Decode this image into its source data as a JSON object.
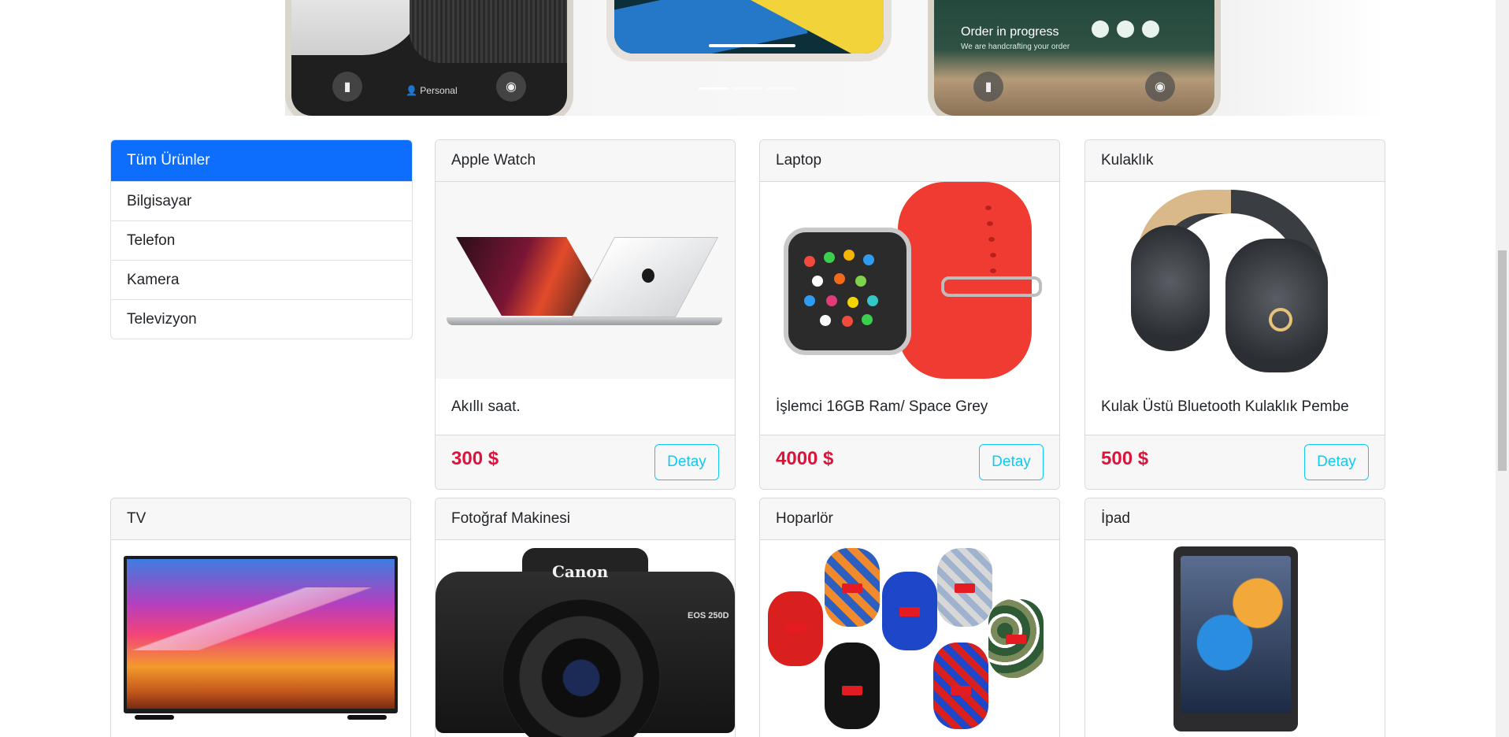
{
  "carousel": {
    "slides": [
      {
        "name": "personal",
        "label": "Personal"
      },
      {
        "name": "wallpaper"
      },
      {
        "name": "order",
        "title": "Order in progress",
        "subtitle": "We are handcrafting your order"
      }
    ],
    "active_index": 0,
    "indicator_count": 3
  },
  "categories": {
    "items": [
      {
        "label": "Tüm Ürünler",
        "active": true
      },
      {
        "label": "Bilgisayar",
        "active": false
      },
      {
        "label": "Telefon",
        "active": false
      },
      {
        "label": "Kamera",
        "active": false
      },
      {
        "label": "Televizyon",
        "active": false
      }
    ]
  },
  "products": [
    {
      "title": "Apple Watch",
      "description": "Akıllı saat.",
      "price": "300 $",
      "button": "Detay",
      "image": "laptop"
    },
    {
      "title": "Laptop",
      "description": "İşlemci 16GB Ram/ Space Grey",
      "price": "4000 $",
      "button": "Detay",
      "image": "watch"
    },
    {
      "title": "Kulaklık",
      "description": "Kulak Üstü Bluetooth Kulaklık Pembe",
      "price": "500 $",
      "button": "Detay",
      "image": "headphones"
    },
    {
      "title": "TV",
      "image": "tv"
    },
    {
      "title": "Fotoğraf Makinesi",
      "image": "camera",
      "brand": "Canon",
      "model": "EOS 250D"
    },
    {
      "title": "Hoparlör",
      "image": "speakers",
      "tag": "T&G"
    },
    {
      "title": "İpad",
      "image": "ipad"
    }
  ],
  "colors": {
    "active_category": "#0d6efd",
    "price": "#dc143c",
    "detail_button": "#0dcaf0"
  }
}
